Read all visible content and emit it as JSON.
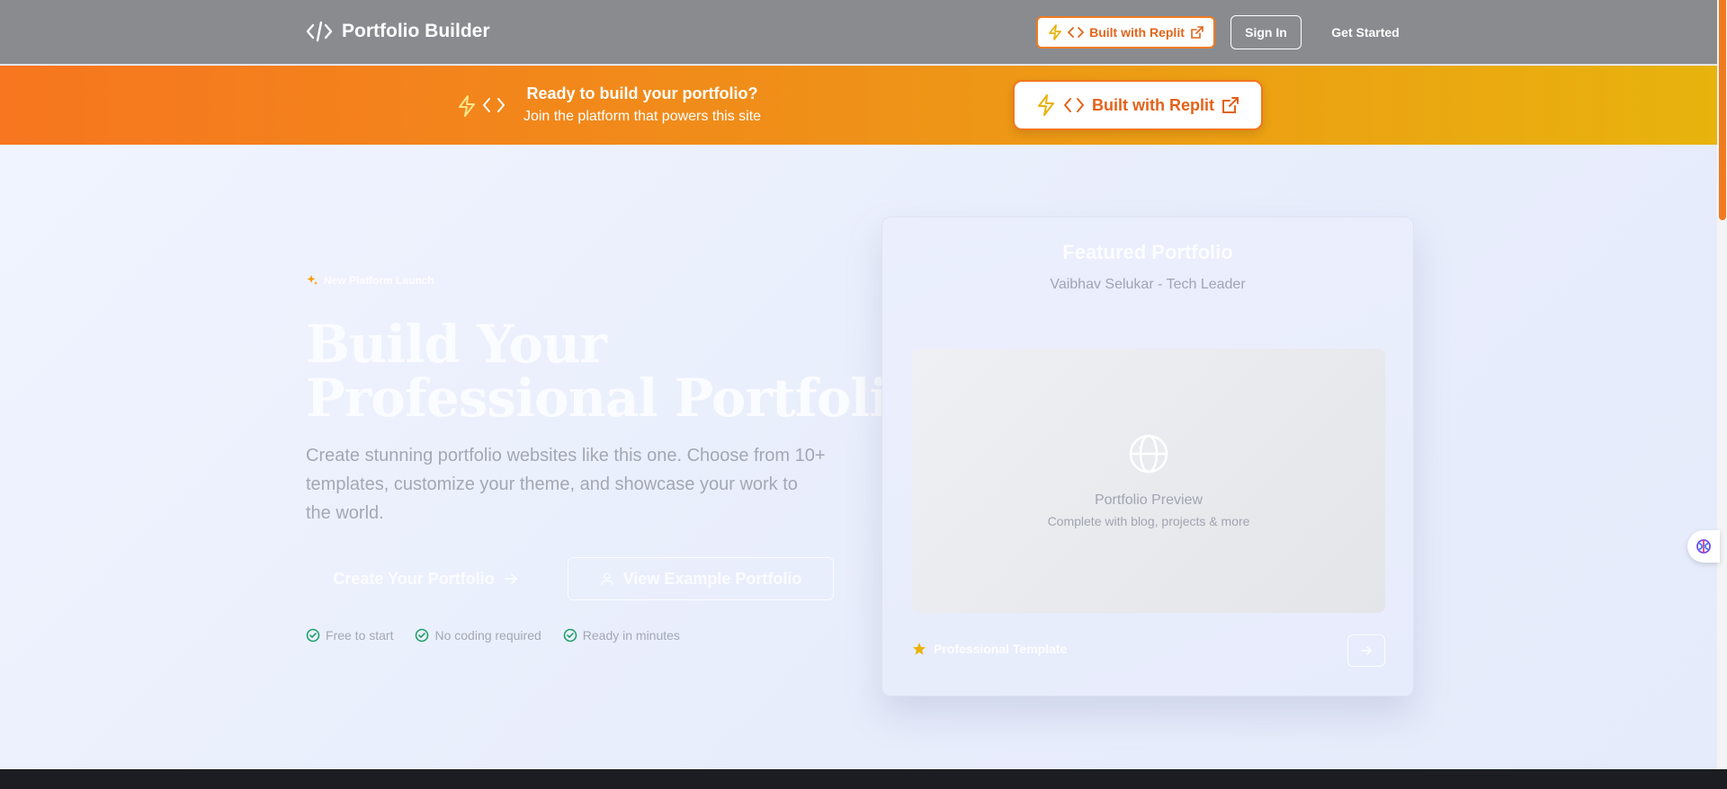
{
  "nav": {
    "brand": "Portfolio Builder",
    "replit_button": "Built with Replit",
    "sign_in": "Sign In",
    "get_started": "Get Started"
  },
  "banner": {
    "title": "Ready to build your portfolio?",
    "subtitle": "Join the platform that powers this site",
    "button": "Built with Replit"
  },
  "hero": {
    "badge": "New Platform Launch",
    "title_line1": "Build Your",
    "title_line2": "Professional Portfolio",
    "description": "Create stunning portfolio websites like this one. Choose from 10+ templates, customize your theme, and showcase your work to the world.",
    "primary_button": "Create Your Portfolio",
    "secondary_button": "View Example Portfolio",
    "checks": [
      "Free to start",
      "No coding required",
      "Ready in minutes"
    ]
  },
  "card": {
    "title": "Featured Portfolio",
    "subtitle": "Vaibhav Selukar - Tech Leader",
    "preview_title": "Portfolio Preview",
    "preview_subtitle": "Complete with blog, projects & more",
    "tag": "Professional Template"
  },
  "colors": {
    "accent_orange": "#f07c1e",
    "banner_start": "#f7761f",
    "banner_end": "#e8b30d",
    "check_green": "#22a06b",
    "star_yellow": "#eab308"
  }
}
